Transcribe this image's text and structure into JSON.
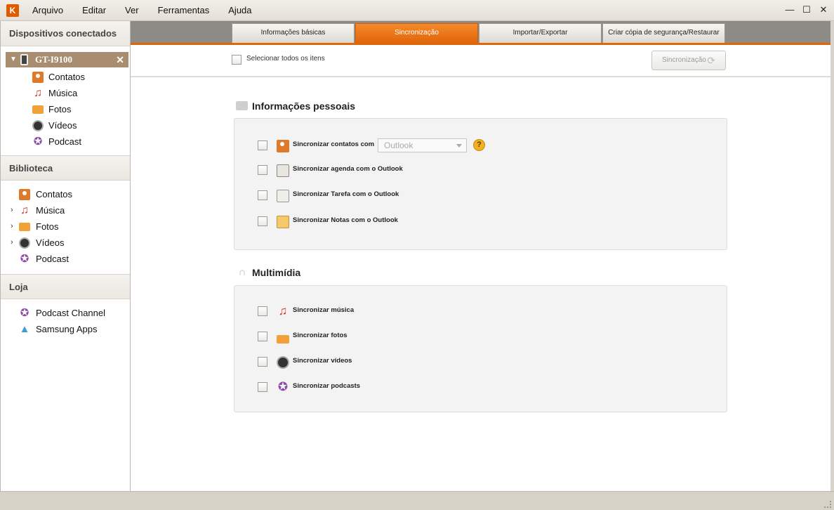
{
  "app": {
    "logo_text": "K",
    "brand_color": "#e0660a"
  },
  "menu": [
    "Arquivo",
    "Editar",
    "Ver",
    "Ferramentas",
    "Ajuda"
  ],
  "window_controls": {
    "minimize": "—",
    "maximize": "☐",
    "close": "✕"
  },
  "sidebar": {
    "connected_header": "Dispositivos conectados",
    "device": {
      "name": "GT-I9100"
    },
    "device_items": [
      {
        "label": "Contatos",
        "icon": "contacts-icon"
      },
      {
        "label": "Música",
        "icon": "music-icon"
      },
      {
        "label": "Fotos",
        "icon": "photos-icon"
      },
      {
        "label": "Vídeos",
        "icon": "videos-icon"
      },
      {
        "label": "Podcast",
        "icon": "podcast-icon"
      }
    ],
    "library_header": "Biblioteca",
    "library_items": [
      {
        "label": "Contatos",
        "icon": "contacts-icon"
      },
      {
        "label": "Música",
        "icon": "music-icon"
      },
      {
        "label": "Fotos",
        "icon": "photos-icon"
      },
      {
        "label": "Vídeos",
        "icon": "videos-icon"
      },
      {
        "label": "Podcast",
        "icon": "podcast-icon"
      }
    ],
    "store_header": "Loja",
    "store_items": [
      {
        "label": "Podcast Channel",
        "icon": "podcast-icon"
      },
      {
        "label": "Samsung Apps",
        "icon": "samsung-apps-icon"
      }
    ]
  },
  "tabs": [
    {
      "label": "Informações básicas",
      "active": false
    },
    {
      "label": "Sincronização",
      "active": true
    },
    {
      "label": "Importar/Exportar",
      "active": false
    },
    {
      "label": "Criar cópia de segurança/Restaurar",
      "active": false
    }
  ],
  "toolbar": {
    "select_all_label": "Selecionar todos os itens",
    "sync_button_label": "Sincronização"
  },
  "personal": {
    "title": "Informações pessoais",
    "rows": [
      {
        "label": "Sincronizar contatos com",
        "icon": "contacts-icon"
      },
      {
        "label": "Sincronizar agenda com o Outlook",
        "icon": "calendar-icon"
      },
      {
        "label": "Sincronizar Tarefa com o Outlook",
        "icon": "task-icon"
      },
      {
        "label": "Sincronizar Notas com o Outlook",
        "icon": "notes-icon"
      }
    ],
    "contacts_select_value": "Outlook",
    "help_symbol": "?"
  },
  "multimedia": {
    "title": "Multimídia",
    "rows": [
      {
        "label": "Sincronizar música",
        "icon": "music-icon"
      },
      {
        "label": "Sincronizar fotos",
        "icon": "photos-icon"
      },
      {
        "label": "Sincronizar vídeos",
        "icon": "videos-icon"
      },
      {
        "label": "Sincronizar podcasts",
        "icon": "podcast-icon"
      }
    ]
  }
}
